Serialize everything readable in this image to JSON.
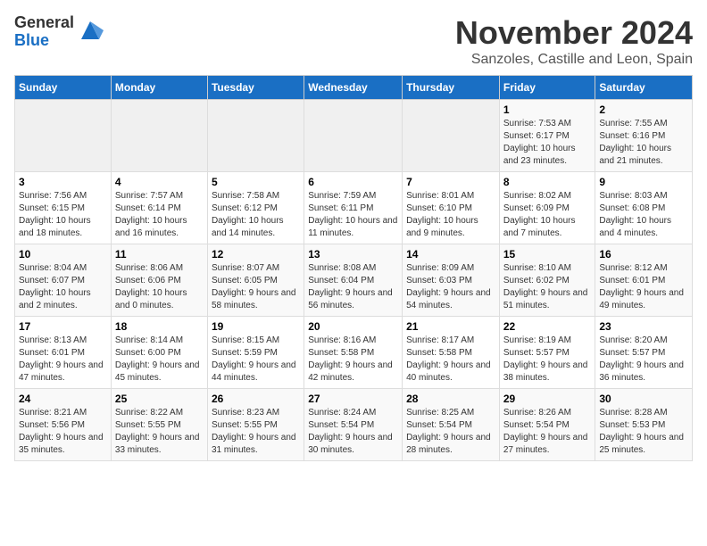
{
  "header": {
    "logo_general": "General",
    "logo_blue": "Blue",
    "month": "November 2024",
    "location": "Sanzoles, Castille and Leon, Spain"
  },
  "days_of_week": [
    "Sunday",
    "Monday",
    "Tuesday",
    "Wednesday",
    "Thursday",
    "Friday",
    "Saturday"
  ],
  "weeks": [
    [
      {
        "day": "",
        "info": ""
      },
      {
        "day": "",
        "info": ""
      },
      {
        "day": "",
        "info": ""
      },
      {
        "day": "",
        "info": ""
      },
      {
        "day": "",
        "info": ""
      },
      {
        "day": "1",
        "info": "Sunrise: 7:53 AM\nSunset: 6:17 PM\nDaylight: 10 hours and 23 minutes."
      },
      {
        "day": "2",
        "info": "Sunrise: 7:55 AM\nSunset: 6:16 PM\nDaylight: 10 hours and 21 minutes."
      }
    ],
    [
      {
        "day": "3",
        "info": "Sunrise: 7:56 AM\nSunset: 6:15 PM\nDaylight: 10 hours and 18 minutes."
      },
      {
        "day": "4",
        "info": "Sunrise: 7:57 AM\nSunset: 6:14 PM\nDaylight: 10 hours and 16 minutes."
      },
      {
        "day": "5",
        "info": "Sunrise: 7:58 AM\nSunset: 6:12 PM\nDaylight: 10 hours and 14 minutes."
      },
      {
        "day": "6",
        "info": "Sunrise: 7:59 AM\nSunset: 6:11 PM\nDaylight: 10 hours and 11 minutes."
      },
      {
        "day": "7",
        "info": "Sunrise: 8:01 AM\nSunset: 6:10 PM\nDaylight: 10 hours and 9 minutes."
      },
      {
        "day": "8",
        "info": "Sunrise: 8:02 AM\nSunset: 6:09 PM\nDaylight: 10 hours and 7 minutes."
      },
      {
        "day": "9",
        "info": "Sunrise: 8:03 AM\nSunset: 6:08 PM\nDaylight: 10 hours and 4 minutes."
      }
    ],
    [
      {
        "day": "10",
        "info": "Sunrise: 8:04 AM\nSunset: 6:07 PM\nDaylight: 10 hours and 2 minutes."
      },
      {
        "day": "11",
        "info": "Sunrise: 8:06 AM\nSunset: 6:06 PM\nDaylight: 10 hours and 0 minutes."
      },
      {
        "day": "12",
        "info": "Sunrise: 8:07 AM\nSunset: 6:05 PM\nDaylight: 9 hours and 58 minutes."
      },
      {
        "day": "13",
        "info": "Sunrise: 8:08 AM\nSunset: 6:04 PM\nDaylight: 9 hours and 56 minutes."
      },
      {
        "day": "14",
        "info": "Sunrise: 8:09 AM\nSunset: 6:03 PM\nDaylight: 9 hours and 54 minutes."
      },
      {
        "day": "15",
        "info": "Sunrise: 8:10 AM\nSunset: 6:02 PM\nDaylight: 9 hours and 51 minutes."
      },
      {
        "day": "16",
        "info": "Sunrise: 8:12 AM\nSunset: 6:01 PM\nDaylight: 9 hours and 49 minutes."
      }
    ],
    [
      {
        "day": "17",
        "info": "Sunrise: 8:13 AM\nSunset: 6:01 PM\nDaylight: 9 hours and 47 minutes."
      },
      {
        "day": "18",
        "info": "Sunrise: 8:14 AM\nSunset: 6:00 PM\nDaylight: 9 hours and 45 minutes."
      },
      {
        "day": "19",
        "info": "Sunrise: 8:15 AM\nSunset: 5:59 PM\nDaylight: 9 hours and 44 minutes."
      },
      {
        "day": "20",
        "info": "Sunrise: 8:16 AM\nSunset: 5:58 PM\nDaylight: 9 hours and 42 minutes."
      },
      {
        "day": "21",
        "info": "Sunrise: 8:17 AM\nSunset: 5:58 PM\nDaylight: 9 hours and 40 minutes."
      },
      {
        "day": "22",
        "info": "Sunrise: 8:19 AM\nSunset: 5:57 PM\nDaylight: 9 hours and 38 minutes."
      },
      {
        "day": "23",
        "info": "Sunrise: 8:20 AM\nSunset: 5:57 PM\nDaylight: 9 hours and 36 minutes."
      }
    ],
    [
      {
        "day": "24",
        "info": "Sunrise: 8:21 AM\nSunset: 5:56 PM\nDaylight: 9 hours and 35 minutes."
      },
      {
        "day": "25",
        "info": "Sunrise: 8:22 AM\nSunset: 5:55 PM\nDaylight: 9 hours and 33 minutes."
      },
      {
        "day": "26",
        "info": "Sunrise: 8:23 AM\nSunset: 5:55 PM\nDaylight: 9 hours and 31 minutes."
      },
      {
        "day": "27",
        "info": "Sunrise: 8:24 AM\nSunset: 5:54 PM\nDaylight: 9 hours and 30 minutes."
      },
      {
        "day": "28",
        "info": "Sunrise: 8:25 AM\nSunset: 5:54 PM\nDaylight: 9 hours and 28 minutes."
      },
      {
        "day": "29",
        "info": "Sunrise: 8:26 AM\nSunset: 5:54 PM\nDaylight: 9 hours and 27 minutes."
      },
      {
        "day": "30",
        "info": "Sunrise: 8:28 AM\nSunset: 5:53 PM\nDaylight: 9 hours and 25 minutes."
      }
    ]
  ]
}
